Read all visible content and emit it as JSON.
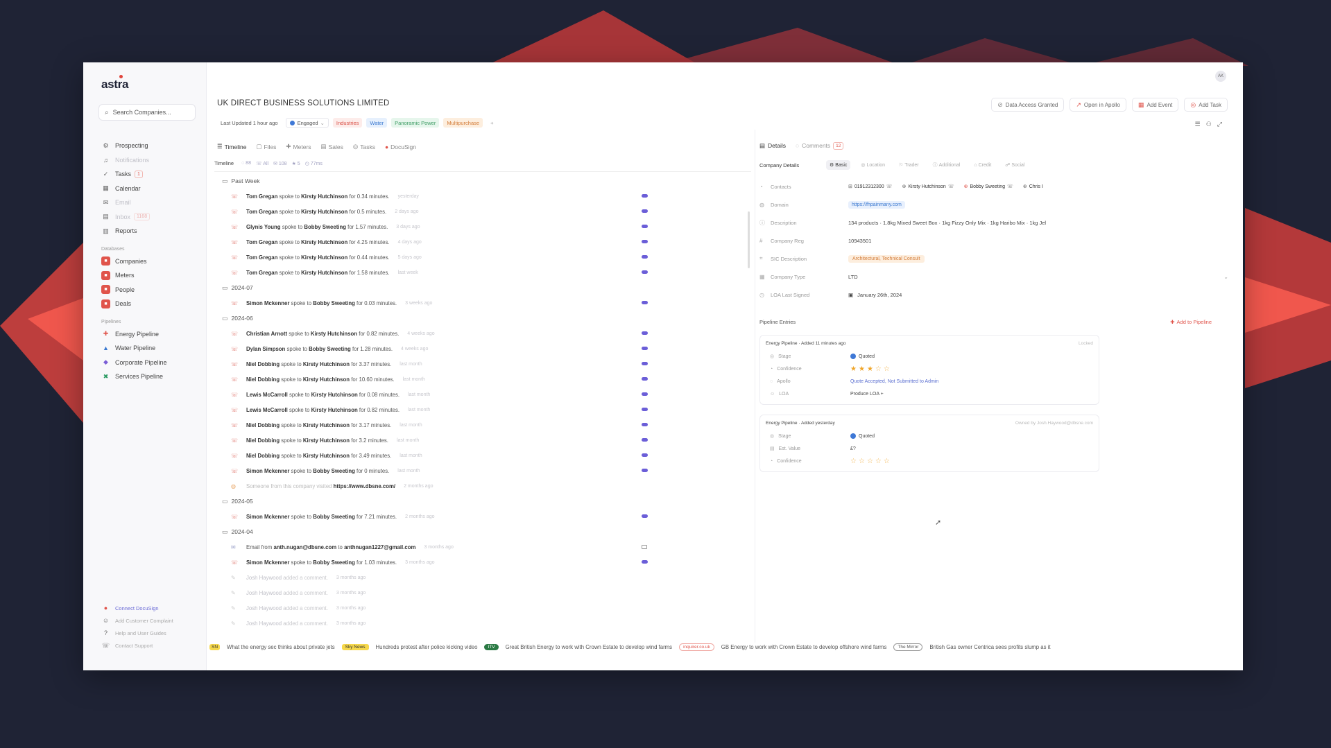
{
  "sidebar": {
    "logo": "astra",
    "search_placeholder": "Search Companies...",
    "nav": [
      {
        "label": "Prospecting",
        "icon": "gear-icon"
      },
      {
        "label": "Notifications",
        "icon": "bell-icon",
        "faded": true
      },
      {
        "label": "Tasks",
        "icon": "check-icon",
        "badge": "1"
      },
      {
        "label": "Calendar",
        "icon": "calendar-icon"
      },
      {
        "label": "Email",
        "icon": "mail-icon",
        "faded": true
      },
      {
        "label": "Inbox",
        "icon": "inbox-icon",
        "badge": "1168",
        "faded": true
      },
      {
        "label": "Reports",
        "icon": "chart-icon"
      }
    ],
    "databases_label": "Databases",
    "databases": [
      {
        "label": "Companies"
      },
      {
        "label": "Meters"
      },
      {
        "label": "People"
      },
      {
        "label": "Deals"
      }
    ],
    "pipelines_label": "Pipelines",
    "pipelines": [
      {
        "label": "Energy Pipeline",
        "icon": "bolt-icon",
        "color": "#e0544b"
      },
      {
        "label": "Water Pipeline",
        "icon": "drop-icon",
        "color": "#3a78d0"
      },
      {
        "label": "Corporate Pipeline",
        "icon": "building-icon",
        "color": "#7b5ed6"
      },
      {
        "label": "Services Pipeline",
        "icon": "tools-icon",
        "color": "#2b9b63"
      }
    ],
    "bottom": [
      {
        "label": "Connect DocuSign",
        "accent": true
      },
      {
        "label": "Add Customer Complaint"
      },
      {
        "label": "Help and User Guides"
      },
      {
        "label": "Contact Support"
      }
    ]
  },
  "header": {
    "avatar": "AK",
    "company_name": "UK DIRECT BUSINESS SOLUTIONS LIMITED",
    "actions": [
      {
        "label": "Data Access Granted",
        "icon": "lock-icon"
      },
      {
        "label": "Open in Apollo",
        "icon": "external-icon"
      },
      {
        "label": "Add Event",
        "icon": "calendar-icon"
      },
      {
        "label": "Add Task",
        "icon": "task-icon"
      }
    ],
    "last_updated": "Last Updated 1 hour ago",
    "status": "Engaged",
    "tags": [
      {
        "label": "Industries",
        "style": "t-red"
      },
      {
        "label": "Water",
        "style": "t-blue"
      },
      {
        "label": "Panoramic Power",
        "style": "t-green"
      },
      {
        "label": "Multipurchase",
        "style": "t-orange"
      }
    ]
  },
  "tabs": [
    {
      "label": "Timeline",
      "active": true
    },
    {
      "label": "Files"
    },
    {
      "label": "Meters"
    },
    {
      "label": "Sales"
    },
    {
      "label": "Tasks"
    },
    {
      "label": "DocuSign"
    }
  ],
  "timeline_stats": {
    "label": "Timeline",
    "items": [
      "88",
      "All",
      "108",
      "5",
      "77ms"
    ]
  },
  "timeline": [
    {
      "group": "Past Week",
      "events": [
        {
          "a": "Tom Gregan",
          "b": "Kirsty Hutchinson",
          "dur": "0.34 minutes.",
          "when": "yesterday"
        },
        {
          "a": "Tom Gregan",
          "b": "Kirsty Hutchinson",
          "dur": "0.5 minutes.",
          "when": "2 days ago"
        },
        {
          "a": "Glynis Young",
          "b": "Bobby Sweeting",
          "dur": "1.57 minutes.",
          "when": "3 days ago"
        },
        {
          "a": "Tom Gregan",
          "b": "Kirsty Hutchinson",
          "dur": "4.25 minutes.",
          "when": "4 days ago"
        },
        {
          "a": "Tom Gregan",
          "b": "Kirsty Hutchinson",
          "dur": "0.44 minutes.",
          "when": "5 days ago"
        },
        {
          "a": "Tom Gregan",
          "b": "Kirsty Hutchinson",
          "dur": "1.58 minutes.",
          "when": "last week"
        }
      ]
    },
    {
      "group": "2024-07",
      "events": [
        {
          "a": "Simon Mckenner",
          "b": "Bobby Sweeting",
          "dur": "0.03 minutes.",
          "when": "3 weeks ago"
        }
      ]
    },
    {
      "group": "2024-06",
      "events": [
        {
          "a": "Christian Arnott",
          "b": "Kirsty Hutchinson",
          "dur": "0.82 minutes.",
          "when": "4 weeks ago"
        },
        {
          "a": "Dylan Simpson",
          "b": "Bobby Sweeting",
          "dur": "1.28 minutes.",
          "when": "4 weeks ago"
        },
        {
          "a": "Niel Dobbing",
          "b": "Kirsty Hutchinson",
          "dur": "3.37 minutes.",
          "when": "last month"
        },
        {
          "a": "Niel Dobbing",
          "b": "Kirsty Hutchinson",
          "dur": "10.60 minutes.",
          "when": "last month"
        },
        {
          "a": "Lewis McCarroll",
          "b": "Kirsty Hutchinson",
          "dur": "0.08 minutes.",
          "when": "last month"
        },
        {
          "a": "Lewis McCarroll",
          "b": "Kirsty Hutchinson",
          "dur": "0.82 minutes.",
          "when": "last month"
        },
        {
          "a": "Niel Dobbing",
          "b": "Kirsty Hutchinson",
          "dur": "3.17 minutes.",
          "when": "last month"
        },
        {
          "a": "Niel Dobbing",
          "b": "Kirsty Hutchinson",
          "dur": "3.2 minutes.",
          "when": "last month"
        },
        {
          "a": "Niel Dobbing",
          "b": "Kirsty Hutchinson",
          "dur": "3.49 minutes.",
          "when": "last month"
        },
        {
          "a": "Simon Mckenner",
          "b": "Bobby Sweeting",
          "dur": "0 minutes.",
          "when": "last month"
        },
        {
          "type": "web",
          "text": "Someone from this company visited",
          "url": "https://www.dbsne.com/",
          "when": "2 months ago"
        }
      ]
    },
    {
      "group": "2024-05",
      "events": [
        {
          "a": "Simon Mckenner",
          "b": "Bobby Sweeting",
          "dur": "7.21 minutes.",
          "when": "2 months ago"
        }
      ]
    },
    {
      "group": "2024-04",
      "events": [
        {
          "type": "mail",
          "from": "anth.nugan@dbsne.com",
          "to": "anthnugan1227@gmail.com",
          "when": "3 months ago"
        },
        {
          "a": "Simon Mckenner",
          "b": "Bobby Sweeting",
          "dur": "1.03 minutes.",
          "when": "3 months ago"
        },
        {
          "type": "comment",
          "who": "Josh Haywood",
          "when": "3 months ago"
        },
        {
          "type": "comment",
          "who": "Josh Haywood",
          "when": "3 months ago"
        },
        {
          "type": "comment",
          "who": "Josh Haywood",
          "when": "3 months ago"
        },
        {
          "type": "comment",
          "who": "Josh Haywood",
          "when": "3 months ago"
        }
      ]
    }
  ],
  "timeline_text": {
    "spoke_to": "spoke to",
    "for": "for",
    "email_from": "Email from",
    "email_to": "to",
    "added_comment": "added a comment."
  },
  "right_panel": {
    "tabs": [
      {
        "label": "Details",
        "active": true
      },
      {
        "label": "Comments",
        "count": "12"
      }
    ],
    "company_details_label": "Company Details",
    "subtabs": [
      {
        "label": "Basic",
        "active": true
      },
      {
        "label": "Location"
      },
      {
        "label": "Trader"
      },
      {
        "label": "Additional"
      },
      {
        "label": "Credit"
      },
      {
        "label": "Social"
      }
    ],
    "fields": {
      "contacts_label": "Contacts",
      "contacts": [
        "01912312300",
        "Kirsty Hutchinson",
        "Bobby Sweeting",
        "Chris I"
      ],
      "domain_label": "Domain",
      "domain": "https://fhpainmany.com",
      "description_label": "Description",
      "description": "134 products · 1.8kg Mixed Sweet Box · 1kg Fizzy Only Mix · 1kg Haribo Mix · 1kg Jel",
      "company_reg_label": "Company Reg",
      "company_reg": "10943501",
      "sic_label": "SIC Description",
      "sic": "Architectural, Technical Consult",
      "company_type_label": "Company Type",
      "company_type": "LTD",
      "loa_label": "LOA Last Signed",
      "loa": "January 26th, 2024"
    },
    "pipeline_entries_label": "Pipeline Entries",
    "add_to_pipeline": "Add to Pipeline",
    "cards": [
      {
        "title": "Energy Pipeline · Added 11 minutes ago",
        "right": "Locked",
        "rows": [
          {
            "label": "Stage",
            "value": "Quoted",
            "type": "status"
          },
          {
            "label": "Confidence",
            "stars": 3,
            "type": "stars"
          },
          {
            "label": "Apollo",
            "value": "Quote Accepted, Not Submitted to Admin",
            "type": "link"
          },
          {
            "label": "LOA",
            "value": "Produce LOA +",
            "type": "text"
          }
        ]
      },
      {
        "title": "Energy Pipeline · Added yesterday",
        "right": "Owned by Josh.Haywood@dbsne.com",
        "rows": [
          {
            "label": "Stage",
            "value": "Quoted",
            "type": "status"
          },
          {
            "label": "Est. Value",
            "value": "£?",
            "type": "text"
          },
          {
            "label": "Confidence",
            "stars": 0,
            "type": "stars"
          }
        ]
      }
    ]
  },
  "ticker": [
    {
      "text": "What the energy sec thinks about private jets",
      "src": "Sky News",
      "src_style": "yel"
    },
    {
      "text": "Hundreds protest after police kicking video",
      "src": "ITV",
      "src_style": "grn"
    },
    {
      "text": "Great British Energy to work with Crown Estate to develop wind farms",
      "src": "inquirer.co.uk",
      "src_style": "pink"
    },
    {
      "text": "GB Energy to work with Crown Estate to develop offshore wind farms",
      "src": "The Mirror",
      "src_style": "gry"
    },
    {
      "text": "British Gas owner Centrica sees profits slump as it",
      "src": "",
      "src_style": ""
    }
  ],
  "ticker_prefix": "SN"
}
